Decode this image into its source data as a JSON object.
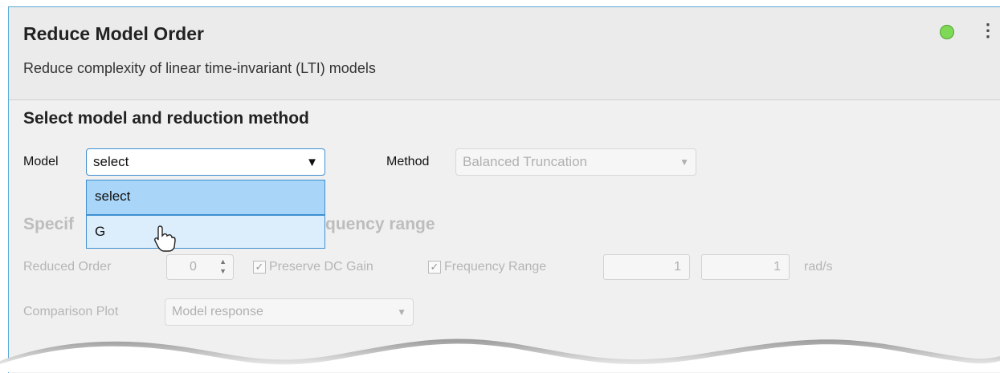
{
  "task": {
    "title": "Reduce Model Order",
    "subtitle": "Reduce complexity of linear time-invariant (LTI) models",
    "status_color": "#7ed957"
  },
  "section1": {
    "title": "Select model and reduction method",
    "model_label": "Model",
    "model_value": "select",
    "method_label": "Method",
    "method_value": "Balanced Truncation"
  },
  "dropdown": {
    "options": [
      "select",
      "G"
    ],
    "selected": "select",
    "hovered": "G"
  },
  "section2": {
    "title_left": "Specif",
    "title_right": "quency range",
    "reduced_order_label": "Reduced Order",
    "reduced_order_value": "0",
    "preserve_dc_label": "Preserve DC Gain",
    "freq_range_label": "Frequency Range",
    "freq_low": "1",
    "freq_high": "1",
    "freq_unit": "rad/s",
    "comparison_label": "Comparison Plot",
    "comparison_value": "Model response"
  },
  "colors": {
    "accent": "#3f8fd0",
    "selected_option": "#a9d5f8",
    "hover_option": "#dcedfb"
  }
}
